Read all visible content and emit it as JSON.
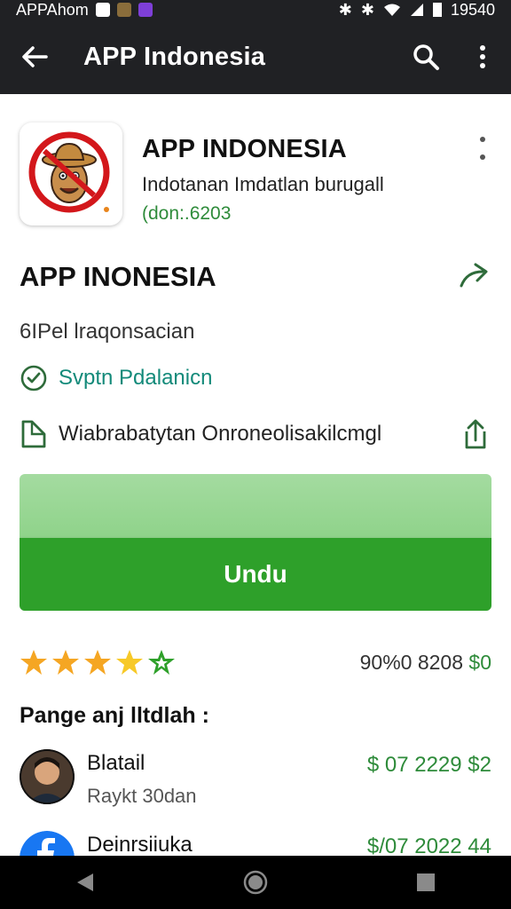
{
  "status_bar": {
    "left_text": "APPAhom",
    "time": "19540"
  },
  "app_bar": {
    "title": "APP Indonesia"
  },
  "app": {
    "name": "APP INDONESIA",
    "developer": "Indotanan Imdatlan burugall",
    "version": "(don:.6203"
  },
  "section": {
    "title": "APP INONESIA",
    "subtitle": "6IPel lraqonsacian",
    "verified_label": "Svptn Pdalanicn",
    "website_label": "Wiabrabatytan Onroneolisakilcmgl"
  },
  "download": {
    "label": "Undu"
  },
  "rating": {
    "stars": 4,
    "value_text": "90%0 8208",
    "price": "$0"
  },
  "list": {
    "title": "Pange anj lltdlah :",
    "items": [
      {
        "name": "Blatail",
        "sub": "Raykt 30dan",
        "price": "$ 07 2229 $2"
      },
      {
        "name": "Deinrsiiuka",
        "sub": "",
        "price": "$/07 2022 44"
      }
    ]
  },
  "colors": {
    "accent_green": "#2ea02a",
    "text_green": "#2e8b3a",
    "teal": "#138a7a",
    "dark_bar": "#202124"
  }
}
